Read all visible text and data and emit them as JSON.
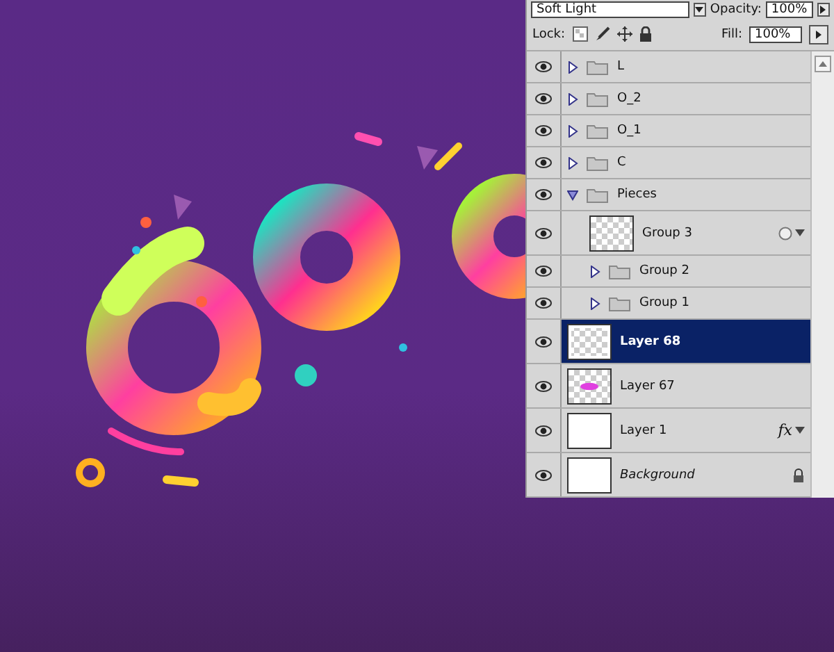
{
  "layers_panel": {
    "blend_mode": "Soft Light",
    "opacity_label": "Opacity:",
    "opacity": "100%",
    "lock_label": "Lock:",
    "fill_label": "Fill:",
    "fill": "100%",
    "layers": [
      {
        "name": "L",
        "kind": "folder",
        "visible": true,
        "expanded": false,
        "selected": false
      },
      {
        "name": "O_2",
        "kind": "folder",
        "visible": true,
        "expanded": false,
        "selected": false
      },
      {
        "name": "O_1",
        "kind": "folder",
        "visible": true,
        "expanded": false,
        "selected": false
      },
      {
        "name": "C",
        "kind": "folder",
        "visible": true,
        "expanded": false,
        "selected": false
      },
      {
        "name": "Pieces",
        "kind": "folder",
        "visible": true,
        "expanded": true,
        "selected": false,
        "children": [
          {
            "name": "Group 3",
            "kind": "smart",
            "visible": true,
            "selected": false,
            "style_icon": true
          },
          {
            "name": "Group 2",
            "kind": "folder",
            "visible": true,
            "expanded": false,
            "selected": false
          },
          {
            "name": "Group 1",
            "kind": "folder",
            "visible": true,
            "expanded": false,
            "selected": false
          }
        ]
      },
      {
        "name": "Layer 68",
        "kind": "dots",
        "visible": true,
        "selected": true
      },
      {
        "name": "Layer 67",
        "kind": "pink",
        "visible": true,
        "selected": false
      },
      {
        "name": "Layer 1",
        "kind": "white",
        "visible": true,
        "selected": false,
        "fx": "fx"
      },
      {
        "name": "Background",
        "kind": "background",
        "visible": true,
        "selected": false,
        "locked": true
      }
    ]
  }
}
